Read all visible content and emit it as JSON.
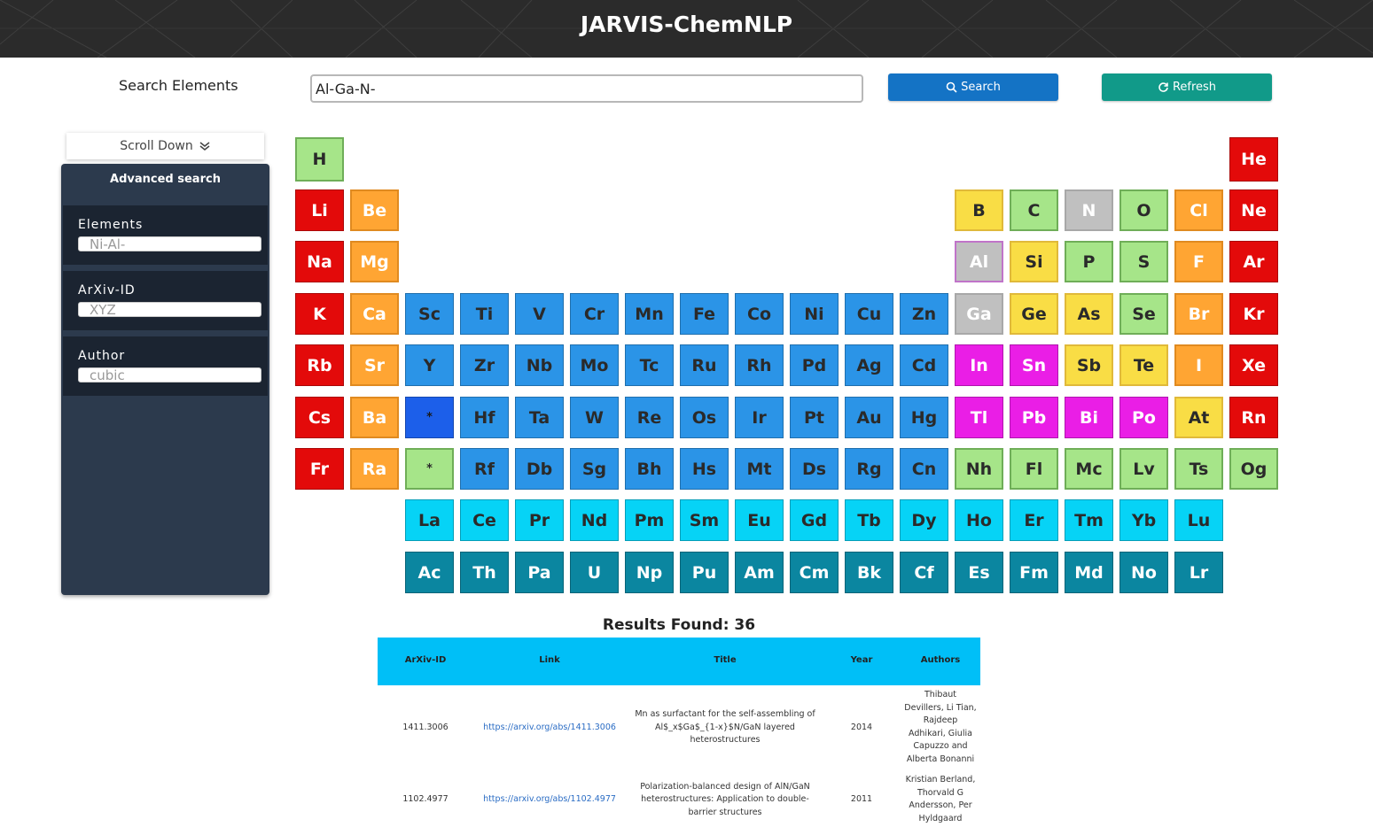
{
  "header": {
    "title": "JARVIS-ChemNLP"
  },
  "search": {
    "label": "Search Elements",
    "value": "Al-Ga-N-",
    "search_button": "Search",
    "refresh_button": "Refresh"
  },
  "sidebar": {
    "scroll_label": "Scroll Down",
    "advanced_title": "Advanced search",
    "fields": [
      {
        "label": "Elements",
        "placeholder": "Ni-Al-"
      },
      {
        "label": "ArXiv-ID",
        "placeholder": "XYZ"
      },
      {
        "label": "Author",
        "placeholder": "cubic"
      }
    ]
  },
  "periodic_table": {
    "colors": {
      "red": "#e30a0a",
      "orange": "#ffa533",
      "yellow": "#f9dd45",
      "lightgreen": "#a6e589",
      "gray": "#c0c0c0",
      "blue": "#2b94e7",
      "darkblue": "#1c5fea",
      "magenta": "#ea1ee6",
      "cyan": "#06d3f6",
      "teal": "#0b86a0"
    },
    "selected": [
      "Al",
      "Ga",
      "N"
    ],
    "rows": [
      [
        [
          "H",
          "lightgreen"
        ],
        null,
        null,
        null,
        null,
        null,
        null,
        null,
        null,
        null,
        null,
        null,
        null,
        null,
        null,
        null,
        null,
        [
          "He",
          "red"
        ]
      ],
      [
        [
          "Li",
          "red"
        ],
        [
          "Be",
          "orange"
        ],
        null,
        null,
        null,
        null,
        null,
        null,
        null,
        null,
        null,
        null,
        [
          "B",
          "yellow"
        ],
        [
          "C",
          "lightgreen"
        ],
        [
          "N",
          "gray"
        ],
        [
          "O",
          "lightgreen"
        ],
        [
          "Cl",
          "orange"
        ],
        [
          "Ne",
          "red"
        ]
      ],
      [
        [
          "Na",
          "red"
        ],
        [
          "Mg",
          "orange"
        ],
        null,
        null,
        null,
        null,
        null,
        null,
        null,
        null,
        null,
        null,
        [
          "Al",
          "gray"
        ],
        [
          "Si",
          "yellow"
        ],
        [
          "P",
          "lightgreen"
        ],
        [
          "S",
          "lightgreen"
        ],
        [
          "F",
          "orange"
        ],
        [
          "Ar",
          "red"
        ]
      ],
      [
        [
          "K",
          "red"
        ],
        [
          "Ca",
          "orange"
        ],
        [
          "Sc",
          "blue"
        ],
        [
          "Ti",
          "blue"
        ],
        [
          "V",
          "blue"
        ],
        [
          "Cr",
          "blue"
        ],
        [
          "Mn",
          "blue"
        ],
        [
          "Fe",
          "blue"
        ],
        [
          "Co",
          "blue"
        ],
        [
          "Ni",
          "blue"
        ],
        [
          "Cu",
          "blue"
        ],
        [
          "Zn",
          "blue"
        ],
        [
          "Ga",
          "gray"
        ],
        [
          "Ge",
          "yellow"
        ],
        [
          "As",
          "yellow"
        ],
        [
          "Se",
          "lightgreen"
        ],
        [
          "Br",
          "orange"
        ],
        [
          "Kr",
          "red"
        ]
      ],
      [
        [
          "Rb",
          "red"
        ],
        [
          "Sr",
          "orange"
        ],
        [
          "Y",
          "blue"
        ],
        [
          "Zr",
          "blue"
        ],
        [
          "Nb",
          "blue"
        ],
        [
          "Mo",
          "blue"
        ],
        [
          "Tc",
          "blue"
        ],
        [
          "Ru",
          "blue"
        ],
        [
          "Rh",
          "blue"
        ],
        [
          "Pd",
          "blue"
        ],
        [
          "Ag",
          "blue"
        ],
        [
          "Cd",
          "blue"
        ],
        [
          "In",
          "magenta"
        ],
        [
          "Sn",
          "magenta"
        ],
        [
          "Sb",
          "yellow"
        ],
        [
          "Te",
          "yellow"
        ],
        [
          "I",
          "orange"
        ],
        [
          "Xe",
          "red"
        ]
      ],
      [
        [
          "Cs",
          "red"
        ],
        [
          "Ba",
          "orange"
        ],
        [
          "*",
          "darkblue"
        ],
        [
          "Hf",
          "blue"
        ],
        [
          "Ta",
          "blue"
        ],
        [
          "W",
          "blue"
        ],
        [
          "Re",
          "blue"
        ],
        [
          "Os",
          "blue"
        ],
        [
          "Ir",
          "blue"
        ],
        [
          "Pt",
          "blue"
        ],
        [
          "Au",
          "blue"
        ],
        [
          "Hg",
          "blue"
        ],
        [
          "Tl",
          "magenta"
        ],
        [
          "Pb",
          "magenta"
        ],
        [
          "Bi",
          "magenta"
        ],
        [
          "Po",
          "magenta"
        ],
        [
          "At",
          "yellow"
        ],
        [
          "Rn",
          "red"
        ]
      ],
      [
        [
          "Fr",
          "red"
        ],
        [
          "Ra",
          "orange"
        ],
        [
          "*",
          "lightgreen"
        ],
        [
          "Rf",
          "blue"
        ],
        [
          "Db",
          "blue"
        ],
        [
          "Sg",
          "blue"
        ],
        [
          "Bh",
          "blue"
        ],
        [
          "Hs",
          "blue"
        ],
        [
          "Mt",
          "blue"
        ],
        [
          "Ds",
          "blue"
        ],
        [
          "Rg",
          "blue"
        ],
        [
          "Cn",
          "blue"
        ],
        [
          "Nh",
          "lightgreen"
        ],
        [
          "Fl",
          "lightgreen"
        ],
        [
          "Mc",
          "lightgreen"
        ],
        [
          "Lv",
          "lightgreen"
        ],
        [
          "Ts",
          "lightgreen"
        ],
        [
          "Og",
          "lightgreen"
        ]
      ],
      [
        null,
        null,
        [
          "La",
          "cyan"
        ],
        [
          "Ce",
          "cyan"
        ],
        [
          "Pr",
          "cyan"
        ],
        [
          "Nd",
          "cyan"
        ],
        [
          "Pm",
          "cyan"
        ],
        [
          "Sm",
          "cyan"
        ],
        [
          "Eu",
          "cyan"
        ],
        [
          "Gd",
          "cyan"
        ],
        [
          "Tb",
          "cyan"
        ],
        [
          "Dy",
          "cyan"
        ],
        [
          "Ho",
          "cyan"
        ],
        [
          "Er",
          "cyan"
        ],
        [
          "Tm",
          "cyan"
        ],
        [
          "Yb",
          "cyan"
        ],
        [
          "Lu",
          "cyan"
        ],
        null
      ],
      [
        null,
        null,
        [
          "Ac",
          "teal"
        ],
        [
          "Th",
          "teal"
        ],
        [
          "Pa",
          "teal"
        ],
        [
          "U",
          "teal"
        ],
        [
          "Np",
          "teal"
        ],
        [
          "Pu",
          "teal"
        ],
        [
          "Am",
          "teal"
        ],
        [
          "Cm",
          "teal"
        ],
        [
          "Bk",
          "teal"
        ],
        [
          "Cf",
          "teal"
        ],
        [
          "Es",
          "teal"
        ],
        [
          "Fm",
          "teal"
        ],
        [
          "Md",
          "teal"
        ],
        [
          "No",
          "teal"
        ],
        [
          "Lr",
          "teal"
        ],
        null
      ]
    ]
  },
  "results": {
    "count_label": "Results Found: 36",
    "columns": [
      "ArXiv-ID",
      "Link",
      "Title",
      "Year",
      "Authors"
    ],
    "rows": [
      {
        "arxiv_id": "1411.3006",
        "link": "https://arxiv.org/abs/1411.3006",
        "title": [
          "Mn as surfactant for the self-assembling of",
          "Al$_x$Ga$_{1-x}$N/GaN layered",
          "heterostructures"
        ],
        "year": "2014",
        "authors": [
          "Thibaut",
          "Devillers, Li Tian,",
          "Rajdeep",
          "Adhikari, Giulia",
          "Capuzzo and",
          "Alberta Bonanni"
        ]
      },
      {
        "arxiv_id": "1102.4977",
        "link": "https://arxiv.org/abs/1102.4977",
        "title": [
          "Polarization-balanced design of AlN/GaN",
          "heterostructures: Application to double-",
          "barrier structures"
        ],
        "year": "2011",
        "authors": [
          "Kristian Berland,",
          "Thorvald G",
          "Andersson, Per",
          "Hyldgaard"
        ]
      }
    ]
  }
}
